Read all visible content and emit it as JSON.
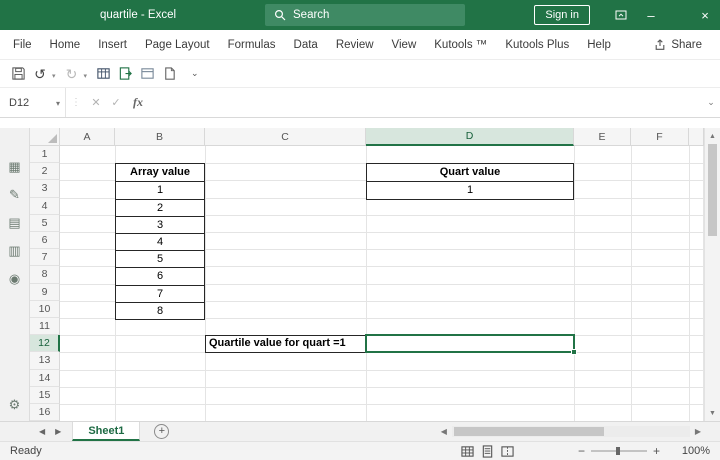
{
  "window": {
    "title": "quartile - Excel",
    "search_placeholder": "Search",
    "sign_in_label": "Sign in"
  },
  "menu_bar": {
    "tabs": [
      "File",
      "Home",
      "Insert",
      "Page Layout",
      "Formulas",
      "Data",
      "Review",
      "View",
      "Kutools ™",
      "Kutools Plus",
      "Help"
    ],
    "share_label": "Share"
  },
  "formula_bar": {
    "name_box": "D12",
    "fx_label": "fx",
    "formula_value": ""
  },
  "grid": {
    "column_headers": [
      "A",
      "B",
      "C",
      "D",
      "E",
      "F"
    ],
    "row_headers": [
      "1",
      "2",
      "3",
      "4",
      "5",
      "6",
      "7",
      "8",
      "9",
      "10",
      "11",
      "12",
      "13",
      "14",
      "15",
      "16"
    ],
    "selected_column": "D",
    "selected_row": "12",
    "selected_cell": "D12",
    "content": {
      "array_header": "Array value",
      "array_values": [
        "1",
        "2",
        "3",
        "4",
        "5",
        "6",
        "7",
        "8"
      ],
      "quart_header": "Quart value",
      "quart_value": "1",
      "c12_label": "Quartile value for quart =1"
    }
  },
  "sheet_bar": {
    "active_tab": "Sheet1"
  },
  "status_bar": {
    "status": "Ready",
    "zoom": "100%"
  }
}
